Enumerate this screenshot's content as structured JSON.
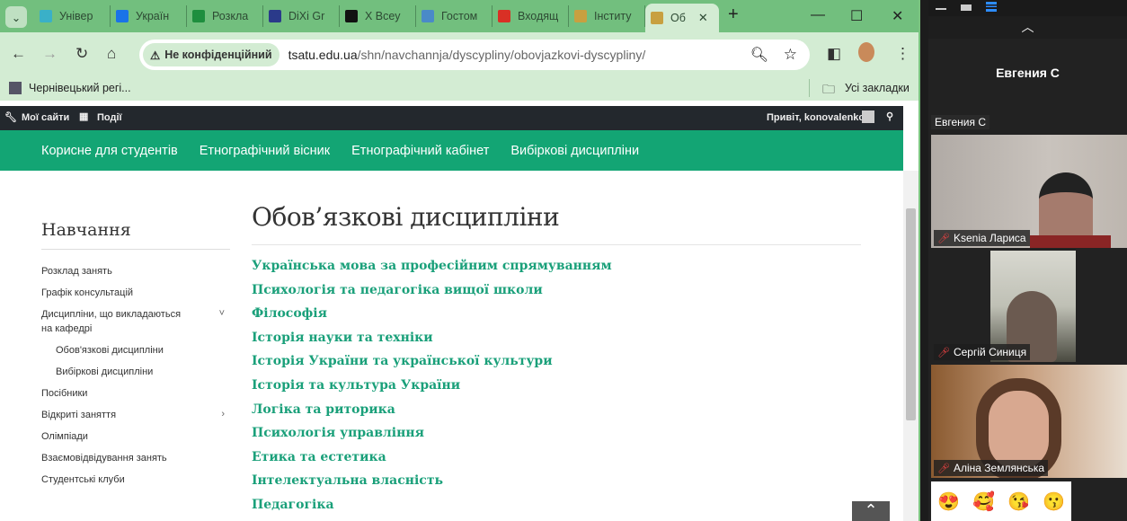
{
  "browser": {
    "tabs": [
      {
        "label": "Універ",
        "color": "#3ab0c8"
      },
      {
        "label": "Україн",
        "color": "#1a73e8"
      },
      {
        "label": "Розкла",
        "color": "#1e8e3e"
      },
      {
        "label": "DiXi Gr",
        "color": "#2a3a8a"
      },
      {
        "label": "X Всеу",
        "color": "#111111"
      },
      {
        "label": "Гостом",
        "color": "#4a8ac8"
      },
      {
        "label": "Входящ",
        "color": "#d93025"
      },
      {
        "label": "Інститу",
        "color": "#c8a040"
      }
    ],
    "active_tab": "Об",
    "new_tab": "+",
    "security_chip": "Не конфіденційний",
    "url_domain": "tsatu.edu.ua",
    "url_path": "/shn/navchannja/dyscypliny/obovjazkovi-dyscypliny/",
    "bookmark": "Чернівецький регі...",
    "all_bookmarks": "Усі закладки"
  },
  "adminbar": {
    "my_sites": "Мої сайти",
    "events": "Події",
    "greeting": "Привіт, konovalenko"
  },
  "nav": [
    "Корисне для студентів",
    "Етнографічний вісник",
    "Етнографічний кабінет",
    "Вибіркові дисципліни"
  ],
  "sidebar": {
    "title": "Навчання",
    "items": [
      {
        "label": "Розклад занять"
      },
      {
        "label": "Графік консультацій"
      },
      {
        "label": "Дисципліни, що викладаються на кафедрі",
        "chevron": "˅"
      },
      {
        "label": "Обов'язкові дисципліни",
        "sub": true
      },
      {
        "label": "Вибіркові дисципліни",
        "sub": true
      },
      {
        "label": "Посібники"
      },
      {
        "label": "Відкриті заняття",
        "chevron": "›"
      },
      {
        "label": "Олімпіади"
      },
      {
        "label": "Взаємовідвідування занять"
      },
      {
        "label": "Студентські клуби"
      }
    ]
  },
  "main": {
    "title": "Обов’язкові дисципліни",
    "courses": [
      "Українська мова за професійним спрямуванням",
      "Психологія та педагогіка вищої школи",
      "Філософія",
      "Історія науки та техніки",
      "Історія України та української культури",
      "Історія та культура України",
      "Логіка та риторика",
      "Психологія управління",
      "Етика та естетика",
      "Інтелектуальна власність",
      "Педагогіка"
    ]
  },
  "zoom": {
    "speaker_big": "Евгения С",
    "speaker_label": "Евгения С",
    "participants": [
      "Ksenia Лариса",
      "Сергій Синиця",
      "Аліна Землянська"
    ],
    "emojis": [
      "😍",
      "🥰",
      "😘",
      "😗"
    ]
  }
}
